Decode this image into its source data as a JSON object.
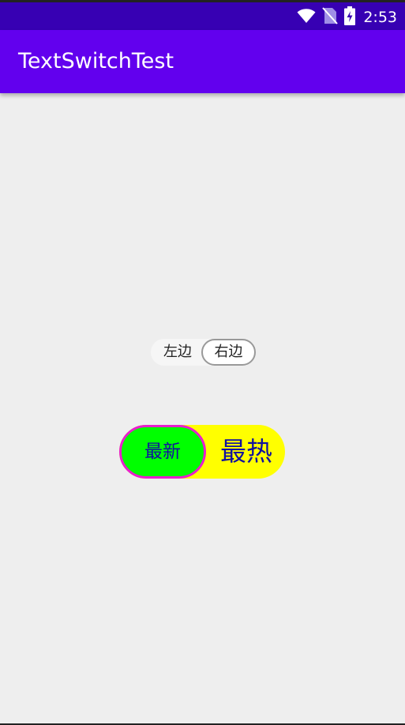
{
  "status_bar": {
    "time": "2:53",
    "icons": [
      "wifi-icon",
      "no-sim-icon",
      "battery-charging-icon"
    ],
    "background": "#3700b3"
  },
  "app_bar": {
    "title": "TextSwitchTest",
    "background": "#6200ee"
  },
  "small_switch": {
    "left_label": "左边",
    "right_label": "右边",
    "selected": "right"
  },
  "big_switch": {
    "left_label": "最新",
    "right_label": "最热",
    "selected": "left",
    "colors": {
      "track": "#ffff00",
      "thumb": "#00ff00",
      "thumb_border": "#e91ecf",
      "text": "#1010a0"
    }
  }
}
